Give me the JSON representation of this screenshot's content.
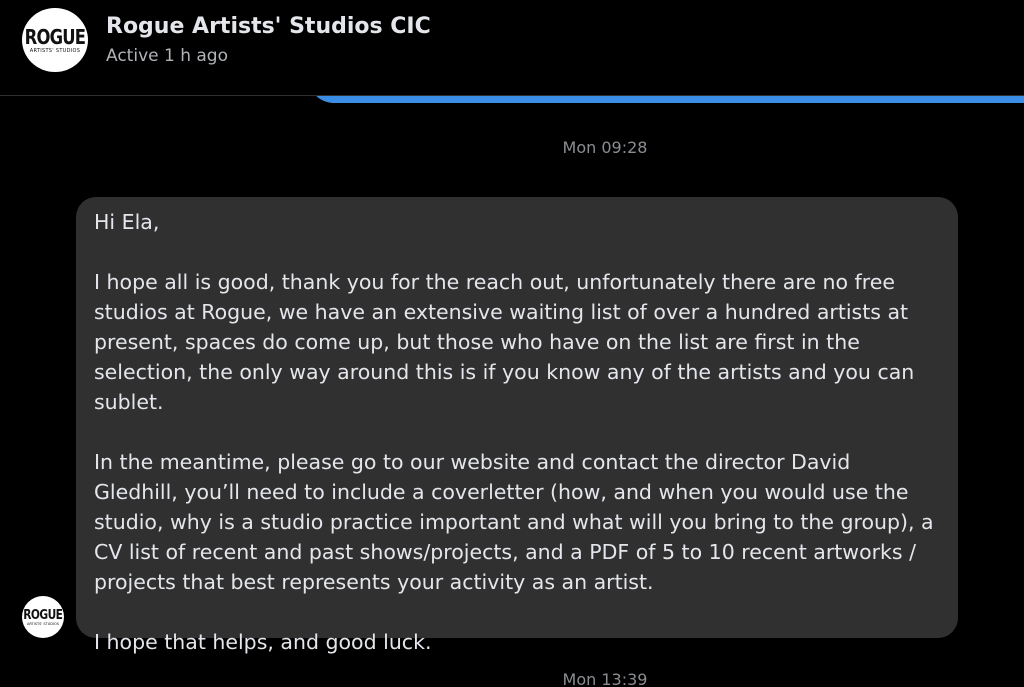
{
  "header": {
    "logo_text": "ROGUE",
    "logo_subtext": "ARTISTS' STUDIOS",
    "contact_name": "Rogue Artists' Studios CIC",
    "status": "Active 1 h ago"
  },
  "colors": {
    "background": "#000000",
    "received_bubble": "#303030",
    "sent_bubble": "#3a8ee6",
    "text": "#e4e6eb",
    "muted_text": "#b0b3b8"
  },
  "conversation": {
    "timestamp_1": "Mon 09:28",
    "message": {
      "p1": "Hi Ela,",
      "p2": "I hope all is good, thank you for the reach out, unfortunately there are no free studios at Rogue, we have an extensive waiting list of over a hundred artists at present, spaces do come up, but those who have on the list are first in the selection, the only way around this is if you know any of the artists and you can sublet.",
      "p3": "In the meantime, please go to our website and contact the director David Gledhill, you’ll need to include a coverletter (how, and when you would use the studio, why is a studio practice important and what will you bring to the group), a CV list of recent and past shows/projects, and a PDF of 5 to 10 recent artworks / projects that best represents your activity as an artist.",
      "p4": "I hope that helps, and good luck."
    },
    "sender_avatar_text": "ROGUE",
    "sender_avatar_subtext": "ARTISTS' STUDIOS",
    "timestamp_2": "Mon 13:39"
  }
}
